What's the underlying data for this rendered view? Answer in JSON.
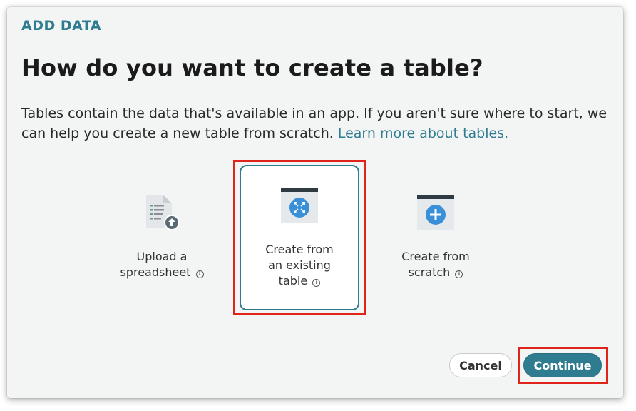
{
  "dialog": {
    "eyebrow": "ADD DATA",
    "title": "How do you want to create a table?",
    "description": "Tables contain the data that's available in an app. If you aren't sure where to start, we can help you create a new table from scratch.",
    "learn_more_link": "Learn more about tables."
  },
  "options": [
    {
      "label_line1": "Upload a",
      "label_line2": "spreadsheet",
      "icon": "spreadsheet-upload-icon"
    },
    {
      "label_line1": "Create from",
      "label_line2": "an existing",
      "label_line3": "table",
      "icon": "table-from-existing-icon",
      "selected": true
    },
    {
      "label_line1": "Create from",
      "label_line2": "scratch",
      "icon": "table-from-scratch-icon"
    }
  ],
  "buttons": {
    "cancel_label": "Cancel",
    "continue_label": "Continue"
  },
  "colors": {
    "accent": "#2f7c90",
    "highlight": "#e0241b",
    "icon_blue": "#3a8fd9",
    "dialog_bg": "#f3f4f4"
  }
}
